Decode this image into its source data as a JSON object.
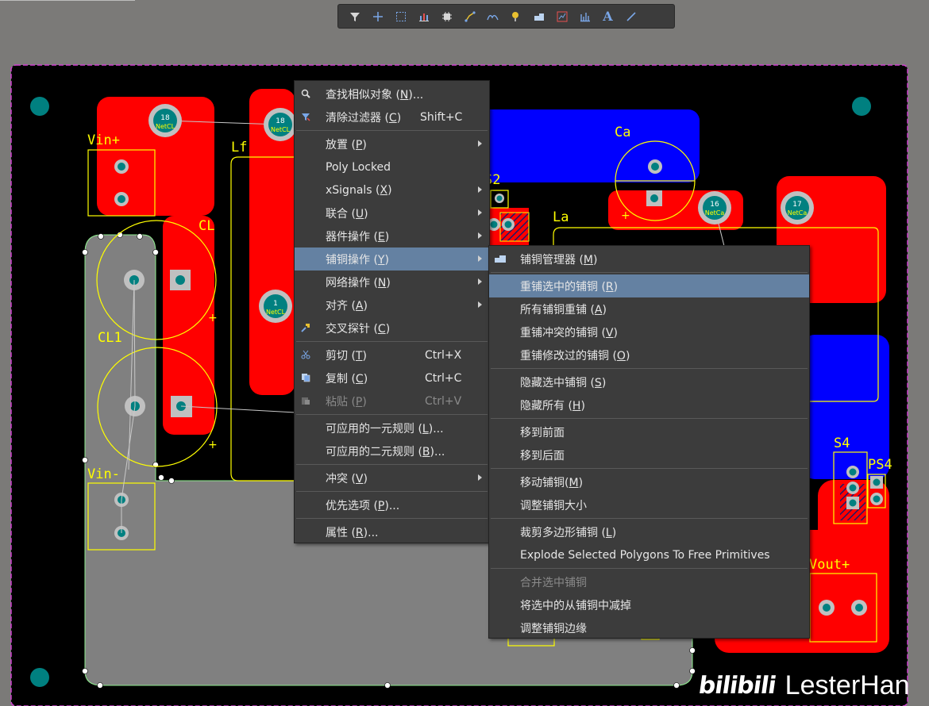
{
  "toolbar": {
    "icons": [
      "filter-icon",
      "crosshair-icon",
      "select-rect-icon",
      "chart-icon",
      "component-icon",
      "route-icon",
      "diff-pair-icon",
      "pad-icon",
      "region-icon",
      "graph-icon",
      "stack-icon",
      "text-icon",
      "line-icon"
    ],
    "text_glyph": "A"
  },
  "board": {
    "designators": {
      "vin_plus": "Vin+",
      "vin_minus": "Vin-",
      "cl": "CL",
      "cl1": "CL1",
      "lf": "Lf",
      "ca": "Ca",
      "la": "La",
      "s2": "S2",
      "s4": "S4",
      "ps4": "PS4",
      "vout_plus": "Vout+",
      "plus_sign": "+"
    },
    "pads": {
      "p18a": "18",
      "p18a_net": "NetCL",
      "p18b": "18",
      "p18b_net": "NetCL",
      "p1": "1",
      "p1_net": "NetCL",
      "p16": "16",
      "p16_net": "NetCa",
      "p17": "17",
      "p17_net": "NetCa"
    },
    "colors": {
      "background": "#000000",
      "top_copper": "#ff0000",
      "bottom_copper": "#0000ff",
      "overlay": "#ffff00",
      "selected_polygon": "#808080",
      "pad_via": "#008080"
    }
  },
  "context_menu": {
    "items": [
      {
        "icon": "search-icon",
        "label": "查找相似对象 (",
        "key": "N",
        "tail": ")..."
      },
      {
        "icon": "clear-filter-icon",
        "label": "清除过滤器 (",
        "key": "C",
        "tail": ")",
        "shortcut": "Shift+C"
      },
      {
        "label": "放置 (",
        "key": "P",
        "tail": ")"
      },
      {
        "label": "Poly Locked"
      },
      {
        "label": "xSignals (",
        "key": "X",
        "tail": ")"
      },
      {
        "label": "联合 (",
        "key": "U",
        "tail": ")"
      },
      {
        "label": "器件操作 (",
        "key": "E",
        "tail": ")"
      },
      {
        "label": "铺铜操作 (",
        "key": "Y",
        "tail": ")"
      },
      {
        "label": "网络操作 (",
        "key": "N",
        "tail": ")"
      },
      {
        "label": "对齐 (",
        "key": "A",
        "tail": ")"
      },
      {
        "icon": "cross-probe-icon",
        "label": "交叉探针 (",
        "key": "C",
        "tail": ")"
      },
      {
        "icon": "cut-icon",
        "label": "剪切 (",
        "key": "T",
        "tail": ")",
        "shortcut": "Ctrl+X"
      },
      {
        "icon": "copy-icon",
        "label": "复制 (",
        "key": "C",
        "tail": ")",
        "shortcut": "Ctrl+C"
      },
      {
        "icon": "paste-icon",
        "label": "粘贴 (",
        "key": "P",
        "tail": ")",
        "shortcut": "Ctrl+V"
      },
      {
        "label": "可应用的一元规则 (",
        "key": "L",
        "tail": ")..."
      },
      {
        "label": "可应用的二元规则 (",
        "key": "B",
        "tail": ")..."
      },
      {
        "label": "冲突 (",
        "key": "V",
        "tail": ")"
      },
      {
        "label": "优先选项 (",
        "key": "P",
        "tail": ")..."
      },
      {
        "label": "属性 (",
        "key": "R",
        "tail": ")..."
      }
    ]
  },
  "submenu": {
    "items": [
      {
        "icon": "polygon-manager-icon",
        "label": "铺铜管理器 (",
        "key": "M",
        "tail": ")"
      },
      {
        "label": "重铺选中的铺铜 (",
        "key": "R",
        "tail": ")"
      },
      {
        "label": "所有铺铜重铺 (",
        "key": "A",
        "tail": ")"
      },
      {
        "label": "重铺冲突的铺铜 (",
        "key": "V",
        "tail": ")"
      },
      {
        "label": "重铺修改过的铺铜 (",
        "key": "O",
        "tail": ")"
      },
      {
        "label": "隐藏选中铺铜 (",
        "key": "S",
        "tail": ")"
      },
      {
        "label": "隐藏所有 (",
        "key": "H",
        "tail": ")"
      },
      {
        "label": "移到前面"
      },
      {
        "label": "移到后面"
      },
      {
        "label": "移动铺铜(",
        "key": "M",
        "tail": ")"
      },
      {
        "label": "调整铺铜大小"
      },
      {
        "label": "裁剪多边形铺铜 (",
        "key": "L",
        "tail": ")"
      },
      {
        "label": "Explode Selected Polygons To Free Primitives"
      },
      {
        "label": "合并选中铺铜"
      },
      {
        "label": "将选中的从铺铜中减掉"
      },
      {
        "label": "调整铺铜边缘"
      }
    ]
  },
  "watermark": {
    "logo": "bilibili",
    "name": "LesterHan"
  }
}
